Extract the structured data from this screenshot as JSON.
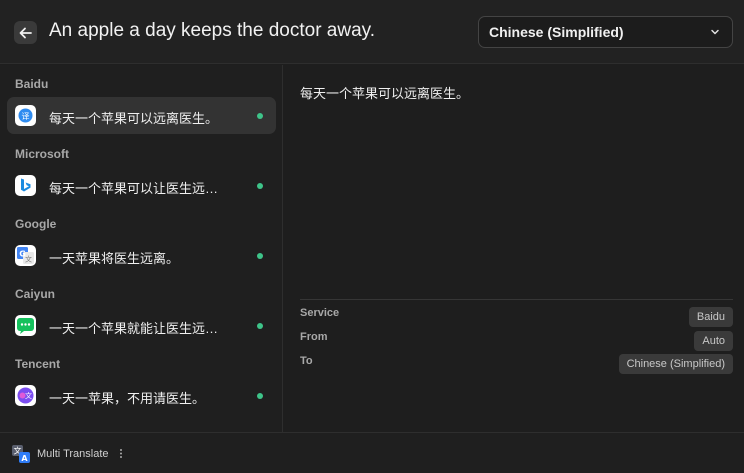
{
  "header": {
    "query_text": "An apple a day keeps the doctor away.",
    "target_language": "Chinese (Simplified)"
  },
  "sidebar": {
    "groups": [
      {
        "service": "Baidu",
        "translation": "每天一个苹果可以远离医生。",
        "status": "ok",
        "active": true
      },
      {
        "service": "Microsoft",
        "translation": "每天一个苹果可以让医生远离我。",
        "status": "ok",
        "active": false
      },
      {
        "service": "Google",
        "translation": "一天苹果将医生远离。",
        "status": "ok",
        "active": false
      },
      {
        "service": "Caiyun",
        "translation": "一天一个苹果就能让医生远离你。",
        "status": "ok",
        "active": false
      },
      {
        "service": "Tencent",
        "translation": "一天一苹果，不用请医生。",
        "status": "ok",
        "active": false
      }
    ]
  },
  "main": {
    "result_text": "每天一个苹果可以远离医生。",
    "details": {
      "service_label": "Service",
      "service_value": "Baidu",
      "from_label": "From",
      "from_value": "Auto",
      "to_label": "To",
      "to_value": "Chinese (Simplified)"
    }
  },
  "footer": {
    "label": "Multi Translate"
  },
  "colors": {
    "status_ok": "#3ec489",
    "background": "#1e1e1e"
  }
}
